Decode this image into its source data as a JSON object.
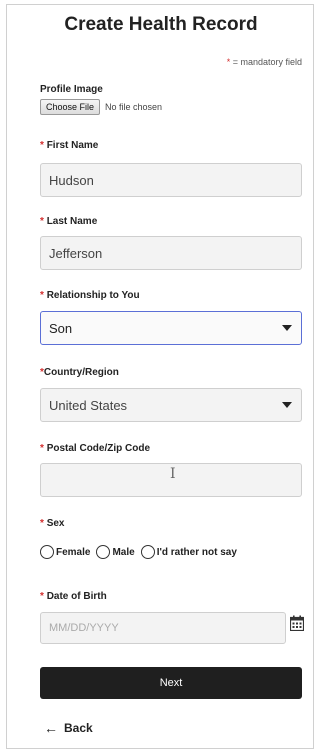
{
  "header": {
    "title": "Create Health Record"
  },
  "mandatory": {
    "asterisk": "*",
    "note": " = mandatory field"
  },
  "profile_image": {
    "label": "Profile Image",
    "button_label": "Choose File",
    "status": "No file chosen"
  },
  "first_name": {
    "label": "First Name",
    "value": "Hudson"
  },
  "last_name": {
    "label": "Last Name",
    "value": "Jefferson"
  },
  "relationship": {
    "label": "Relationship to You",
    "value": "Son"
  },
  "country": {
    "label": "Country/Region",
    "value": "United States"
  },
  "postal": {
    "label": "Postal Code/Zip Code",
    "value": "",
    "cursor_glyph": "I"
  },
  "sex": {
    "label": "Sex",
    "options": [
      "Female",
      "Male",
      "I'd rather not say"
    ]
  },
  "dob": {
    "label": "Date of Birth",
    "placeholder": "MM/DD/YYYY"
  },
  "actions": {
    "next_label": "Next",
    "back_label": "Back",
    "back_arrow": "←"
  },
  "colors": {
    "required": "#d32f2f",
    "primary_button": "#1f1f1f",
    "focus_border": "#5b6fd6"
  },
  "icons": {
    "dropdown": "chevron-down-icon",
    "calendar": "calendar-icon",
    "back": "arrow-left-icon"
  }
}
